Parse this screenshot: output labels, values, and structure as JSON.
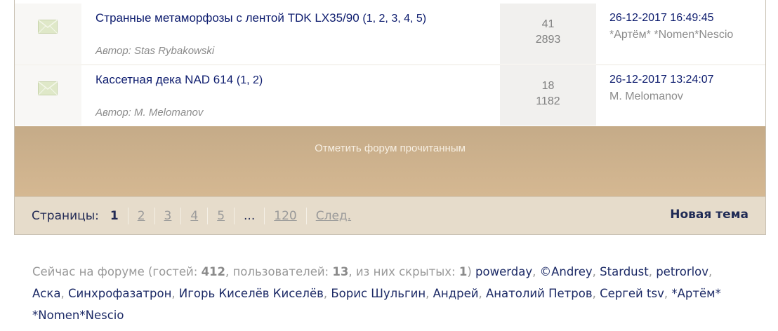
{
  "topics": [
    {
      "title": "Странные метаморфозы с лентой TDK LX35/90",
      "pages": "(1, 2, 3, 4, 5)",
      "author": "Автор: Stas Rybakowski",
      "replies": "41",
      "views": "2893",
      "last_date": "26-12-2017 16:49:45",
      "last_user": "*Артём* *Nomen*Nescio",
      "icon": "envelope-icon"
    },
    {
      "title": "Кассетная дека NAD 614",
      "pages": "(1, 2)",
      "author": "Автор: M. Melomanov",
      "replies": "18",
      "views": "1182",
      "last_date": "26-12-2017 13:24:07",
      "last_user": "M. Melomanov",
      "icon": "envelope-icon"
    }
  ],
  "mark_read": "Отметить форум прочитанным",
  "pagination": {
    "label": "Страницы:",
    "current": "1",
    "pages": [
      "2",
      "3",
      "4",
      "5"
    ],
    "ellipsis": "...",
    "last": "120",
    "next": "След."
  },
  "new_topic": "Новая тема",
  "online": {
    "prefix": "Сейчас на форуме (гостей:",
    "guests": "412",
    "users_label": ", пользователей:",
    "users": "13",
    "hidden_label": ", из них скрытых:",
    "hidden": "1",
    "close": ")",
    "names": [
      "powerday",
      "©Andrey",
      "Stardust",
      "petrorlov",
      "Аска",
      "Синхрофазатрон",
      "Игорь Киселёв Киселёв",
      "Борис Шульгин",
      "Андрей",
      "Анатолий Петров",
      "Сергей tsv",
      "*Артём* *Nomen*Nescio"
    ]
  },
  "colors": {
    "link": "#0d1c6e",
    "bar": "#cdb08b",
    "pager_bg": "#e6dccb"
  }
}
